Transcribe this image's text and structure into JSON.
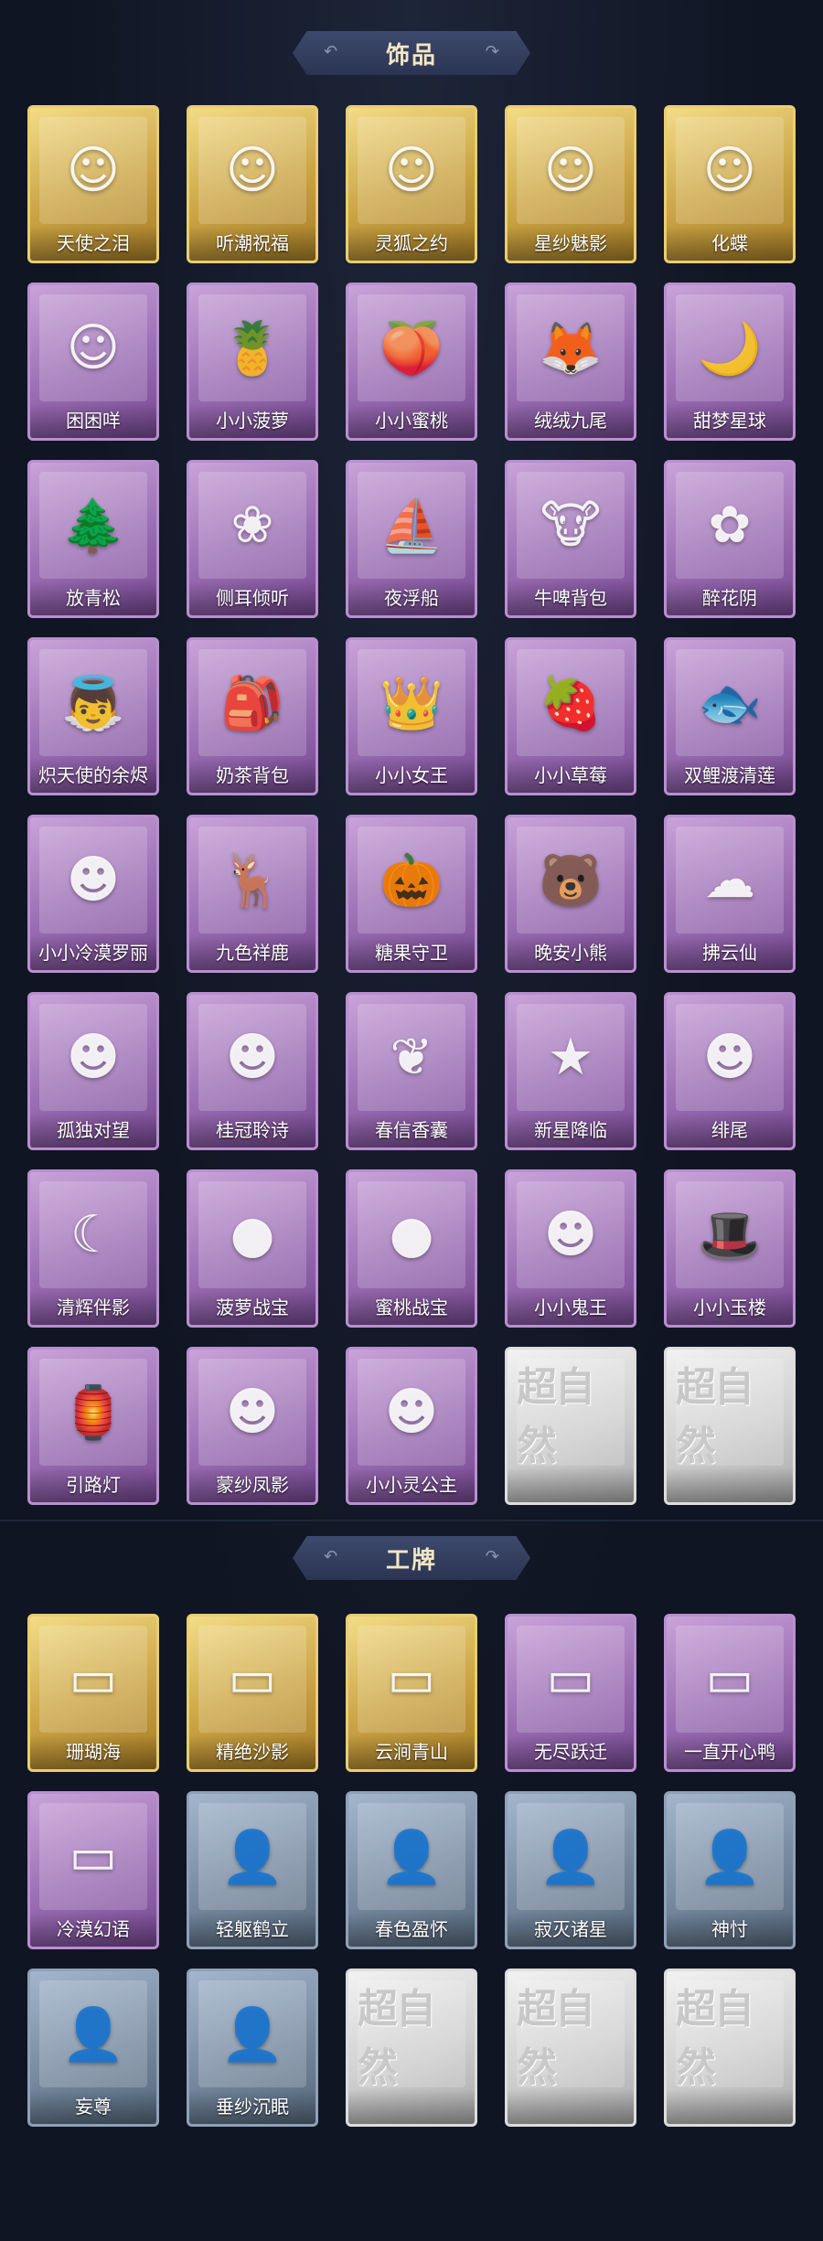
{
  "sections": [
    {
      "title": "饰品",
      "items": [
        {
          "name": "天使之泪",
          "rarity": "gold",
          "icon": "angel-bust-icon",
          "glyph": "☺"
        },
        {
          "name": "听潮祝福",
          "rarity": "gold",
          "icon": "bust-with-ornament-icon",
          "glyph": "☺"
        },
        {
          "name": "灵狐之约",
          "rarity": "gold",
          "icon": "bust-with-fox-ears-icon",
          "glyph": "☺"
        },
        {
          "name": "星纱魅影",
          "rarity": "gold",
          "icon": "bust-with-veil-icon",
          "glyph": "☺"
        },
        {
          "name": "化蝶",
          "rarity": "gold",
          "icon": "bust-with-butterfly-icon",
          "glyph": "☺"
        },
        {
          "name": "困困咩",
          "rarity": "purple",
          "icon": "bust-icon",
          "glyph": "☺"
        },
        {
          "name": "小小菠萝",
          "rarity": "purple",
          "icon": "pineapple-pet-icon",
          "glyph": "🍍"
        },
        {
          "name": "小小蜜桃",
          "rarity": "purple",
          "icon": "peach-pet-icon",
          "glyph": "🍑"
        },
        {
          "name": "绒绒九尾",
          "rarity": "purple",
          "icon": "nine-tail-fox-icon",
          "glyph": "🦊"
        },
        {
          "name": "甜梦星球",
          "rarity": "purple",
          "icon": "moon-planet-icon",
          "glyph": "🌙"
        },
        {
          "name": "放青松",
          "rarity": "purple",
          "icon": "bonsai-pine-icon",
          "glyph": "🌲"
        },
        {
          "name": "侧耳倾听",
          "rarity": "purple",
          "icon": "flower-ear-ornament-icon",
          "glyph": "❀"
        },
        {
          "name": "夜浮船",
          "rarity": "purple",
          "icon": "ghost-ship-icon",
          "glyph": "⛵"
        },
        {
          "name": "牛啤背包",
          "rarity": "purple",
          "icon": "cow-beer-backpack-icon",
          "glyph": "🐮"
        },
        {
          "name": "醉花阴",
          "rarity": "purple",
          "icon": "dreamcatcher-icon",
          "glyph": "✿"
        },
        {
          "name": "炽天使的余烬",
          "rarity": "purple",
          "icon": "seraph-doll-icon",
          "glyph": "👼"
        },
        {
          "name": "奶茶背包",
          "rarity": "purple",
          "icon": "milk-tea-backpack-icon",
          "glyph": "🎒"
        },
        {
          "name": "小小女王",
          "rarity": "purple",
          "icon": "queen-doll-icon",
          "glyph": "👑"
        },
        {
          "name": "小小草莓",
          "rarity": "purple",
          "icon": "strawberry-pet-icon",
          "glyph": "🍓"
        },
        {
          "name": "双鲤渡清莲",
          "rarity": "purple",
          "icon": "koi-lotus-icon",
          "glyph": "🐟"
        },
        {
          "name": "小小冷漠罗丽",
          "rarity": "purple",
          "icon": "gothic-doll-icon",
          "glyph": "☻"
        },
        {
          "name": "九色祥鹿",
          "rarity": "purple",
          "icon": "deer-charm-icon",
          "glyph": "🦌"
        },
        {
          "name": "糖果守卫",
          "rarity": "purple",
          "icon": "pumpkin-guard-icon",
          "glyph": "🎃"
        },
        {
          "name": "晚安小熊",
          "rarity": "purple",
          "icon": "bear-charm-icon",
          "glyph": "🐻"
        },
        {
          "name": "拂云仙",
          "rarity": "purple",
          "icon": "fairy-charm-icon",
          "glyph": "☁"
        },
        {
          "name": "孤独对望",
          "rarity": "purple",
          "icon": "doll-charm-icon",
          "glyph": "☻"
        },
        {
          "name": "桂冠聆诗",
          "rarity": "purple",
          "icon": "laurel-doll-charm-icon",
          "glyph": "☻"
        },
        {
          "name": "春信香囊",
          "rarity": "purple",
          "icon": "sachet-charm-icon",
          "glyph": "❦"
        },
        {
          "name": "新星降临",
          "rarity": "purple",
          "icon": "star-doll-charm-icon",
          "glyph": "★"
        },
        {
          "name": "绯尾",
          "rarity": "purple",
          "icon": "fox-girl-charm-icon",
          "glyph": "☻"
        },
        {
          "name": "清辉伴影",
          "rarity": "purple",
          "icon": "moon-doll-charm-icon",
          "glyph": "☾"
        },
        {
          "name": "菠萝战宝",
          "rarity": "purple",
          "icon": "pineapple-robot-charm-icon",
          "glyph": "●"
        },
        {
          "name": "蜜桃战宝",
          "rarity": "purple",
          "icon": "peach-robot-charm-icon",
          "glyph": "●"
        },
        {
          "name": "小小鬼王",
          "rarity": "purple",
          "icon": "ghost-king-doll-icon",
          "glyph": "☻"
        },
        {
          "name": "小小玉楼",
          "rarity": "purple",
          "icon": "gentleman-doll-icon",
          "glyph": "🎩"
        },
        {
          "name": "引路灯",
          "rarity": "purple",
          "icon": "lantern-charm-icon",
          "glyph": "🏮"
        },
        {
          "name": "蒙纱凤影",
          "rarity": "purple",
          "icon": "phoenix-doll-charm-icon",
          "glyph": "☻"
        },
        {
          "name": "小小灵公主",
          "rarity": "purple",
          "icon": "princess-doll-icon",
          "glyph": "☻"
        },
        {
          "name": "",
          "rarity": "silver",
          "icon": "locked-logo-icon",
          "glyph": "超自然"
        },
        {
          "name": "",
          "rarity": "silver",
          "icon": "locked-logo-icon",
          "glyph": "超自然"
        }
      ]
    },
    {
      "title": "工牌",
      "items": [
        {
          "name": "珊瑚海",
          "rarity": "gold",
          "icon": "coral-sea-badge-icon",
          "glyph": "▭"
        },
        {
          "name": "精绝沙影",
          "rarity": "gold",
          "icon": "sand-badge-icon",
          "glyph": "▭"
        },
        {
          "name": "云涧青山",
          "rarity": "gold",
          "icon": "mountain-badge-icon",
          "glyph": "▭"
        },
        {
          "name": "无尽跃迁",
          "rarity": "purple",
          "icon": "galaxy-badge-icon",
          "glyph": "▭"
        },
        {
          "name": "一直开心鸭",
          "rarity": "purple",
          "icon": "duck-badge-icon",
          "glyph": "▭"
        },
        {
          "name": "冷漠幻语",
          "rarity": "purple",
          "icon": "violet-badge-icon",
          "glyph": "▭"
        },
        {
          "name": "轻躯鹤立",
          "rarity": "blue",
          "icon": "silhouette-badge-icon",
          "glyph": "👤"
        },
        {
          "name": "春色盈怀",
          "rarity": "blue",
          "icon": "silhouette-badge-icon",
          "glyph": "👤"
        },
        {
          "name": "寂灭诸星",
          "rarity": "blue",
          "icon": "silhouette-badge-icon",
          "glyph": "👤"
        },
        {
          "name": "神忖",
          "rarity": "blue",
          "icon": "silhouette-badge-icon",
          "glyph": "👤"
        },
        {
          "name": "妄尊",
          "rarity": "blue",
          "icon": "silhouette-badge-icon",
          "glyph": "👤"
        },
        {
          "name": "垂纱沉眠",
          "rarity": "blue",
          "icon": "silhouette-badge-icon",
          "glyph": "👤"
        },
        {
          "name": "",
          "rarity": "silver",
          "icon": "locked-logo-icon",
          "glyph": "超自然"
        },
        {
          "name": "",
          "rarity": "silver",
          "icon": "locked-logo-icon",
          "glyph": "超自然"
        },
        {
          "name": "",
          "rarity": "silver",
          "icon": "locked-logo-icon",
          "glyph": "超自然"
        }
      ]
    }
  ],
  "colors": {
    "background": "#101523",
    "title_text": "#f4e6c2",
    "gold": "#caa344",
    "purple": "#9a6db3",
    "blue": "#76899f",
    "silver": "#cfcfcf"
  }
}
